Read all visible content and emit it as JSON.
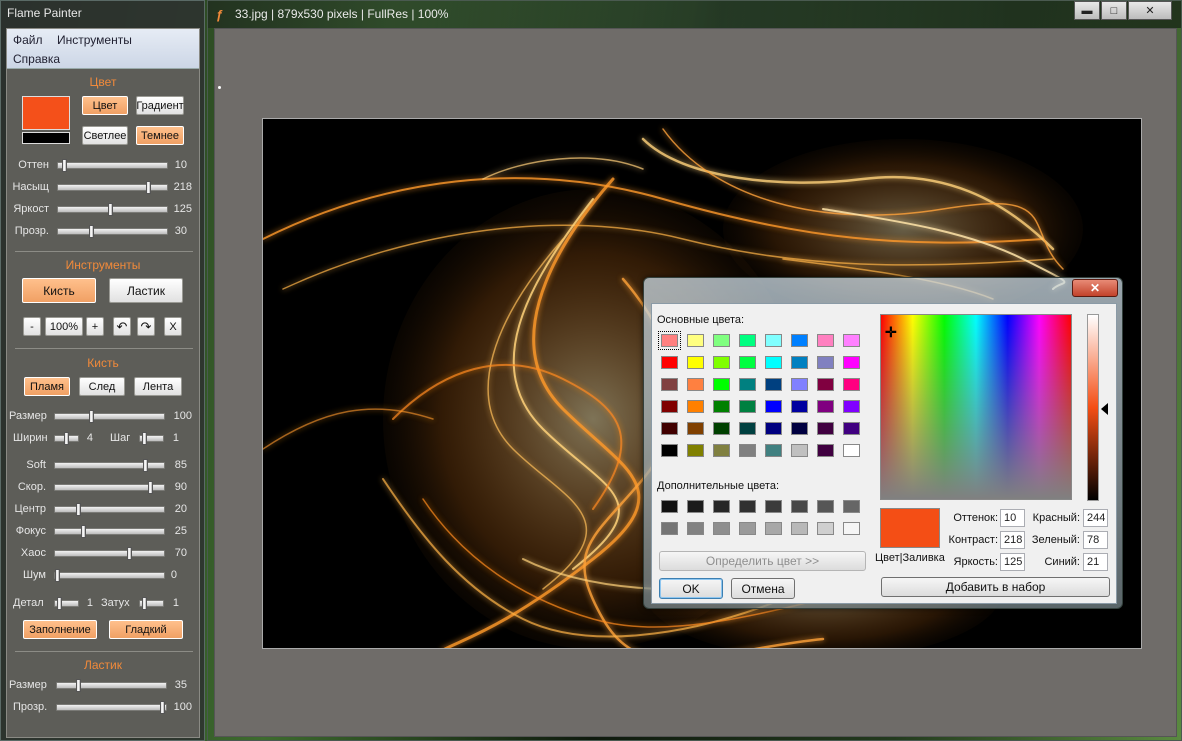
{
  "panel": {
    "title": "Flame Painter",
    "menu": [
      "Файл",
      "Инструменты",
      "Справка"
    ],
    "color_section": {
      "heading": "Цвет",
      "swatch_main": "#f4501a",
      "swatch_secondary": "#000000",
      "btn_color": "Цвет",
      "btn_gradient": "Градиент",
      "btn_lighter": "Светлее",
      "btn_darker": "Темнее",
      "sliders": [
        {
          "label": "Оттен",
          "value": "10",
          "frac": 0.04
        },
        {
          "label": "Насыщ",
          "value": "218",
          "frac": 0.85
        },
        {
          "label": "Яркост",
          "value": "125",
          "frac": 0.49
        },
        {
          "label": "Прозр.",
          "value": "30",
          "frac": 0.3
        }
      ]
    },
    "tools_section": {
      "heading": "Инструменты",
      "btn_brush": "Кисть",
      "btn_eraser": "Ластик",
      "zoom_minus": "-",
      "zoom_value": "100%",
      "zoom_plus": "+",
      "undo_icon": "↶",
      "redo_icon": "↷",
      "clear": "X"
    },
    "brush_section": {
      "heading": "Кисть",
      "btn_flame": "Пламя",
      "btn_trail": "След",
      "btn_ribbon": "Лента",
      "size": {
        "label": "Размер",
        "value": "100",
        "frac": 0.33
      },
      "width": {
        "label": "Ширин",
        "value": "4",
        "frac": 0.5
      },
      "step": {
        "label": "Шаг",
        "value": "1",
        "frac": 0.1
      },
      "sliders": [
        {
          "label": "Soft",
          "value": "85",
          "frac": 0.85
        },
        {
          "label": "Скор.",
          "value": "90",
          "frac": 0.9
        },
        {
          "label": "Центр",
          "value": "20",
          "frac": 0.2
        },
        {
          "label": "Фокус",
          "value": "25",
          "frac": 0.25
        },
        {
          "label": "Хаос",
          "value": "70",
          "frac": 0.7
        },
        {
          "label": "Шум",
          "value": "0",
          "frac": 0.0
        }
      ],
      "detail": {
        "label": "Детал",
        "value": "1",
        "frac": 0.1
      },
      "fade": {
        "label": "Затух",
        "value": "1",
        "frac": 0.1
      },
      "btn_fill": "Заполнение",
      "btn_smooth": "Гладкий"
    },
    "eraser_section": {
      "heading": "Ластик",
      "sliders": [
        {
          "label": "Размер",
          "value": "35",
          "frac": 0.18
        },
        {
          "label": "Прозр.",
          "value": "100",
          "frac": 1.0
        }
      ]
    }
  },
  "main": {
    "title": "33.jpg | 879x530 pixels | FullRes | 100%",
    "logo_icon": "flame-logo-icon",
    "win_minimize": "▬",
    "win_maximize": "□",
    "win_close": "✕"
  },
  "dialog": {
    "close": "✕",
    "basic_label": "Основные цвета:",
    "basic_colors": [
      [
        "#ff8080",
        "#ffff80",
        "#80ff80",
        "#00ff80",
        "#80ffff",
        "#0080ff",
        "#ff80c0",
        "#ff80ff"
      ],
      [
        "#ff0000",
        "#ffff00",
        "#80ff00",
        "#00ff40",
        "#00ffff",
        "#0080c0",
        "#8080c0",
        "#ff00ff"
      ],
      [
        "#804040",
        "#ff8040",
        "#00ff00",
        "#008080",
        "#004080",
        "#8080ff",
        "#800040",
        "#ff0080"
      ],
      [
        "#800000",
        "#ff8000",
        "#008000",
        "#008040",
        "#0000ff",
        "#0000a0",
        "#800080",
        "#8000ff"
      ],
      [
        "#400000",
        "#804000",
        "#004000",
        "#004040",
        "#000080",
        "#000040",
        "#400040",
        "#400080"
      ],
      [
        "#000000",
        "#808000",
        "#808040",
        "#808080",
        "#408080",
        "#c0c0c0",
        "#400040",
        "#ffffff"
      ]
    ],
    "custom_label": "Дополнительные цвета:",
    "custom_colors": [
      [
        "#111111",
        "#1c1c1c",
        "#262626",
        "#303030",
        "#3b3b3b",
        "#474747",
        "#565656",
        "#666666"
      ],
      [
        "#757575",
        "#828282",
        "#8e8e8e",
        "#9a9a9a",
        "#a8a8a8",
        "#b8b8b8",
        "#cfcfcf",
        "#f5f5f5"
      ]
    ],
    "define_btn": "Определить цвет >>",
    "ok_btn": "OK",
    "cancel_btn": "Отмена",
    "preview_color": "#f44e15",
    "preview_label": "Цвет|Заливка",
    "hue_label": "Оттенок:",
    "hue_value": "10",
    "sat_label": "Контраст:",
    "sat_value": "218",
    "lum_label": "Яркость:",
    "lum_value": "125",
    "red_label": "Красный:",
    "red_value": "244",
    "green_label": "Зеленый:",
    "green_value": "78",
    "blue_label": "Синий:",
    "blue_value": "21",
    "add_btn": "Добавить в набор",
    "luminance_level": 0.49
  }
}
